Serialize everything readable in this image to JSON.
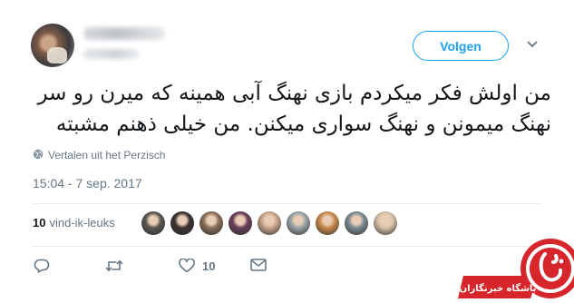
{
  "header": {
    "follow_label": "Volgen"
  },
  "tweet": {
    "text_line1": "من اولش فکر میکردم بازی نهنگ آبی همینه که میرن رو سر",
    "text_line2": "نهنگ میمونن و نهنگ سواری میکنن. من خیلی ذهنم مشبته",
    "translate_label": "Vertalen uit het Perzisch",
    "timestamp": "15:04 - 7 sep. 2017"
  },
  "stats": {
    "likes_count": "10",
    "likes_label": "vind-ik-leuks",
    "liker_colors": [
      "#5b5651",
      "#3a3230",
      "#8a6e58",
      "#6a3f5a",
      "#c9a58c",
      "#9aa4a8",
      "#c98a4d",
      "#7e8c94",
      "#d8c2a8"
    ]
  },
  "actions": {
    "reply_icon": "reply-icon",
    "retweet_icon": "retweet-icon",
    "like_icon": "heart-icon",
    "like_count": "10",
    "dm_icon": "envelope-icon"
  },
  "watermark": {
    "brand_text": "باشگاه خبرنگاران"
  },
  "colors": {
    "accent": "#1da1f2",
    "muted": "#657786",
    "watermark_red": "#d7262b"
  }
}
